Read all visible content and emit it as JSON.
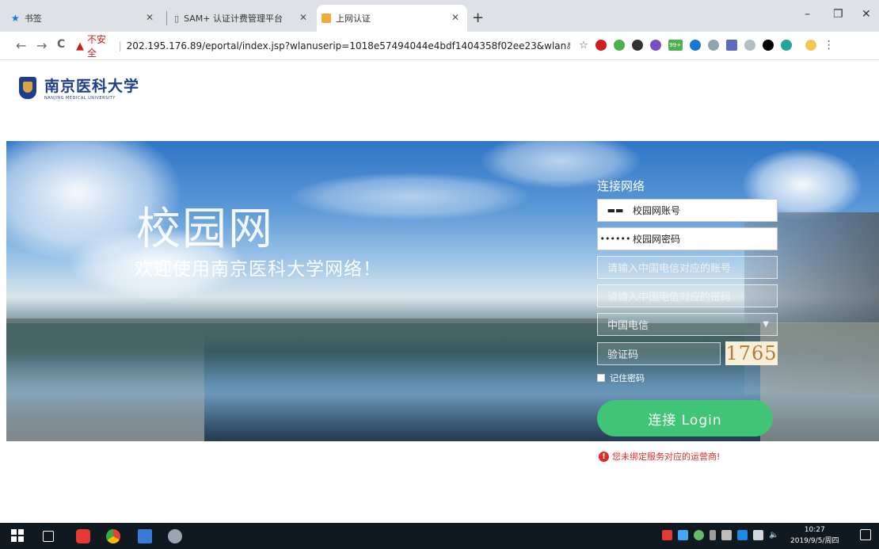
{
  "browser": {
    "tabs": [
      {
        "title": "书签",
        "active": false
      },
      {
        "title": "SAM+ 认证计费管理平台",
        "active": false
      },
      {
        "title": "上网认证",
        "active": true
      }
    ],
    "new_tab_symbol": "+",
    "window_controls": {
      "minimize": "–",
      "restore": "❐",
      "close": "✕"
    },
    "nav": {
      "back": "←",
      "forward": "→",
      "reload": "C"
    },
    "security_label": "不安全",
    "url": "202.195.176.89/eportal/index.jsp?wlanuserip=1018e57494044e4bdf1404358f02ee23&wlanacna...",
    "extension_badge": "99+",
    "accent_color": "#c5221f"
  },
  "page": {
    "logo": {
      "name_cn": "南京医科大学",
      "name_en": "NANJING MEDICAL UNIVERSITY"
    },
    "hero": {
      "title": "校园网",
      "subtitle": "欢迎使用南京医科大学网络！"
    },
    "login": {
      "title": "连接网络",
      "username_label": "校园网账号",
      "password_mask": "••••••",
      "password_label": "校园网密码",
      "carrier_account_placeholder": "请输入中国电信对应的账号",
      "carrier_password_placeholder": "请输入中国电信对应的密码",
      "carrier_selected": "中国电信",
      "captcha_placeholder": "验证码",
      "captcha_code": "1765",
      "remember_label": "记住密码",
      "submit_label": "连接 Login",
      "button_color": "#40c475"
    },
    "error_message": "您未绑定服务对应的运营商!",
    "error_color": "#e02a2a"
  },
  "taskbar": {
    "time": "10:27",
    "date": "2019/9/5/周四",
    "volume_icon": "🔈"
  }
}
